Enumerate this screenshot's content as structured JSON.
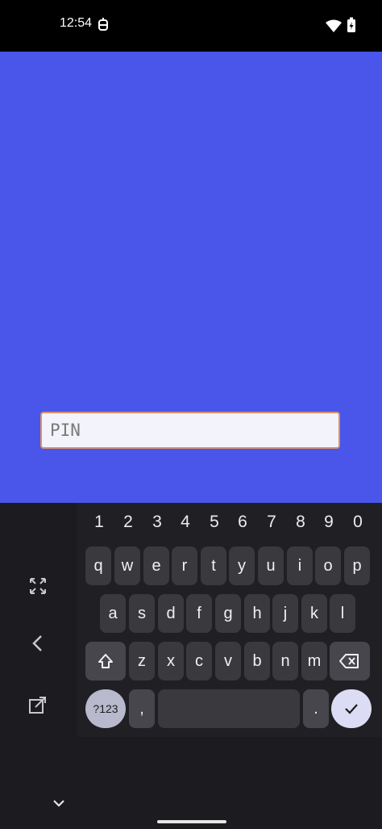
{
  "status_bar": {
    "time": "12:54"
  },
  "pin_field": {
    "placeholder": "PIN",
    "value": ""
  },
  "keyboard": {
    "number_row": [
      "1",
      "2",
      "3",
      "4",
      "5",
      "6",
      "7",
      "8",
      "9",
      "0"
    ],
    "row1": [
      "q",
      "w",
      "e",
      "r",
      "t",
      "y",
      "u",
      "i",
      "o",
      "p"
    ],
    "row2": [
      "a",
      "s",
      "d",
      "f",
      "g",
      "h",
      "j",
      "k",
      "l"
    ],
    "row3": [
      "z",
      "x",
      "c",
      "v",
      "b",
      "n",
      "m"
    ],
    "symbols_label": "?123",
    "comma_label": ",",
    "period_label": "."
  },
  "colors": {
    "app_background": "#4a55ea",
    "field_border": "#d8906a",
    "keyboard_background": "#1c1b1f"
  }
}
